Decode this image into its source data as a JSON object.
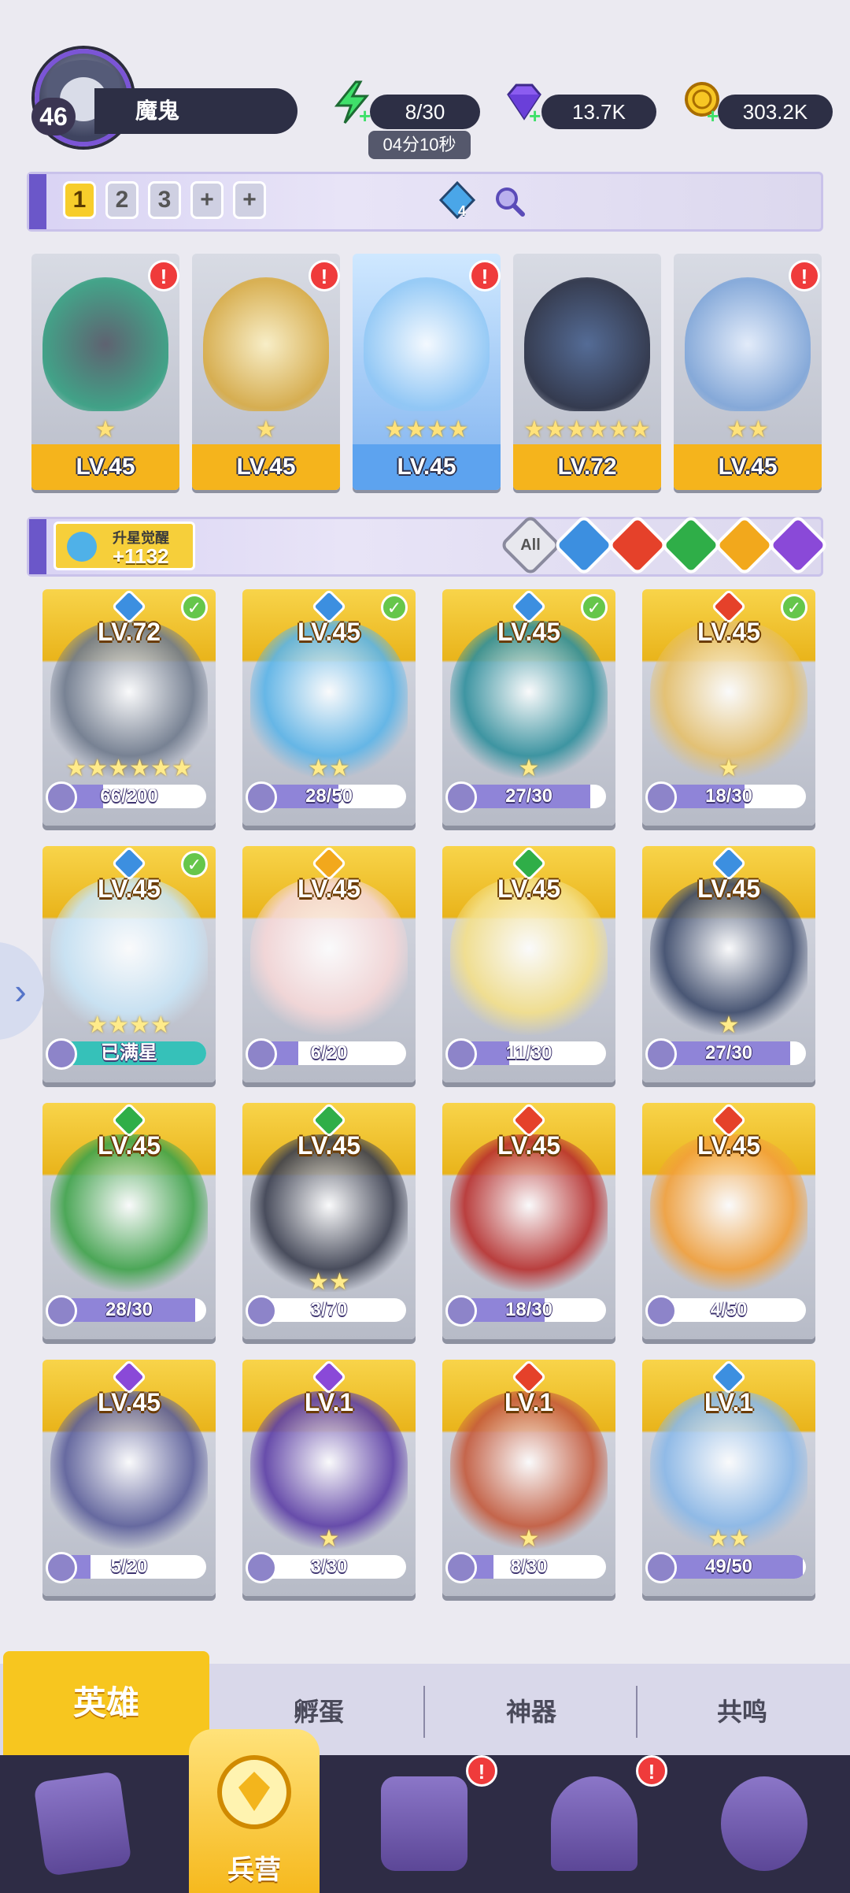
{
  "player": {
    "name": "魔鬼",
    "level": "46"
  },
  "resources": {
    "energy": "8/30",
    "energy_timer": "04分10秒",
    "gems": "13.7K",
    "gold": "303.2K"
  },
  "team_bar": {
    "slots": [
      "1",
      "2",
      "3",
      "+",
      "+"
    ],
    "token_count": "4"
  },
  "team": [
    {
      "level": "LV.45",
      "stars": "★",
      "alert": "!"
    },
    {
      "level": "LV.45",
      "stars": "★",
      "alert": "!"
    },
    {
      "level": "LV.45",
      "stars": "★★★★",
      "alert": "!"
    },
    {
      "level": "LV.72",
      "stars": "★★★★★★",
      "alert": ""
    },
    {
      "level": "LV.45",
      "stars": "★★",
      "alert": "!"
    }
  ],
  "filter_bar": {
    "awaken_label": "升星觉醒",
    "awaken_value": "+1132",
    "all_label": "All"
  },
  "heroes": [
    {
      "level": "LV.72",
      "progress": "66/200",
      "fraction": 0.33,
      "stars": "★★★★★★",
      "element": "water",
      "check": "✓"
    },
    {
      "level": "LV.45",
      "progress": "28/50",
      "fraction": 0.56,
      "stars": "★★",
      "element": "water",
      "check": "✓"
    },
    {
      "level": "LV.45",
      "progress": "27/30",
      "fraction": 0.9,
      "stars": "★",
      "element": "water",
      "check": "✓"
    },
    {
      "level": "LV.45",
      "progress": "18/30",
      "fraction": 0.6,
      "stars": "★",
      "element": "fire",
      "check": "✓"
    },
    {
      "level": "LV.45",
      "progress": "已满星",
      "fraction": 1,
      "stars": "★★★★",
      "element": "water",
      "check": "✓"
    },
    {
      "level": "LV.45",
      "progress": "6/20",
      "fraction": 0.3,
      "stars": "",
      "element": "light",
      "check": ""
    },
    {
      "level": "LV.45",
      "progress": "11/30",
      "fraction": 0.37,
      "stars": "",
      "element": "wind",
      "check": ""
    },
    {
      "level": "LV.45",
      "progress": "27/30",
      "fraction": 0.9,
      "stars": "★",
      "element": "water",
      "check": ""
    },
    {
      "level": "LV.45",
      "progress": "28/30",
      "fraction": 0.93,
      "stars": "",
      "element": "wind",
      "check": ""
    },
    {
      "level": "LV.45",
      "progress": "3/70",
      "fraction": 0.04,
      "stars": "★★",
      "element": "wind",
      "check": ""
    },
    {
      "level": "LV.45",
      "progress": "18/30",
      "fraction": 0.6,
      "stars": "",
      "element": "fire",
      "check": ""
    },
    {
      "level": "LV.45",
      "progress": "4/50",
      "fraction": 0.08,
      "stars": "",
      "element": "fire",
      "check": ""
    },
    {
      "level": "LV.45",
      "progress": "5/20",
      "fraction": 0.25,
      "stars": "",
      "element": "dark",
      "check": ""
    },
    {
      "level": "LV.1",
      "progress": "3/30",
      "fraction": 0.1,
      "stars": "★",
      "element": "dark",
      "check": ""
    },
    {
      "level": "LV.1",
      "progress": "8/30",
      "fraction": 0.27,
      "stars": "★",
      "element": "fire",
      "check": ""
    },
    {
      "level": "LV.1",
      "progress": "49/50",
      "fraction": 0.98,
      "stars": "★★",
      "element": "water",
      "check": ""
    }
  ],
  "element_colors": {
    "water": "#3c8fe0",
    "fire": "#e5412a",
    "wind": "#2fae48",
    "light": "#f2a81c",
    "dark": "#8a49d8"
  },
  "tabs": {
    "heroes": "英雄",
    "hatch": "孵蛋",
    "artifact": "神器",
    "resonance": "共鸣"
  },
  "nav": {
    "barracks": "兵营",
    "alert": "!"
  }
}
